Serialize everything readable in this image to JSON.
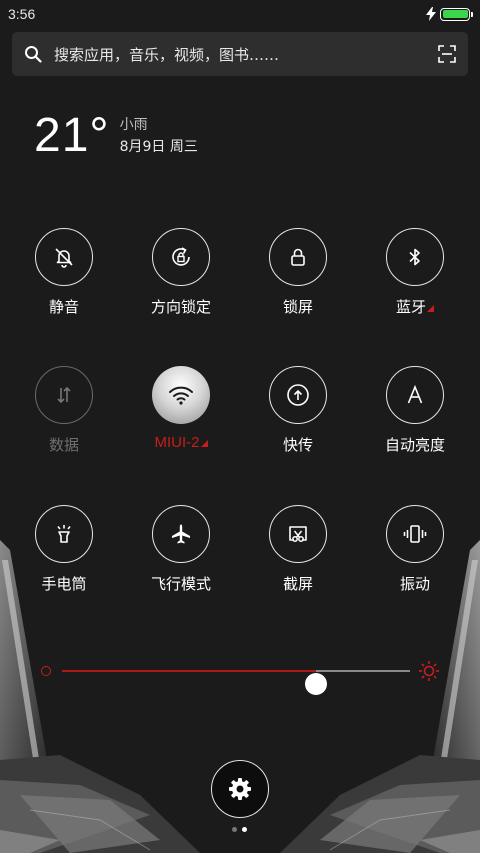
{
  "status_bar": {
    "time": "3:56"
  },
  "search": {
    "placeholder": "搜索应用，音乐，视频，图书……"
  },
  "weather": {
    "temperature": "21°",
    "condition": "小雨",
    "date": "8月9日 周三"
  },
  "toggles": [
    {
      "label": "静音",
      "icon": "bell-off-icon",
      "state": "off"
    },
    {
      "label": "方向锁定",
      "icon": "rotation-lock-icon",
      "state": "off"
    },
    {
      "label": "锁屏",
      "icon": "lock-icon",
      "state": "off"
    },
    {
      "label": "蓝牙",
      "icon": "bluetooth-icon",
      "state": "off"
    },
    {
      "label": "数据",
      "icon": "data-arrows-icon",
      "state": "disabled"
    },
    {
      "label": "MIUI-2",
      "icon": "wifi-icon",
      "state": "on"
    },
    {
      "label": "快传",
      "icon": "quick-transfer-icon",
      "state": "off"
    },
    {
      "label": "自动亮度",
      "icon": "auto-brightness-icon",
      "state": "off"
    },
    {
      "label": "手电筒",
      "icon": "flashlight-icon",
      "state": "off"
    },
    {
      "label": "飞行模式",
      "icon": "airplane-icon",
      "state": "off"
    },
    {
      "label": "截屏",
      "icon": "screenshot-icon",
      "state": "off"
    },
    {
      "label": "振动",
      "icon": "vibrate-icon",
      "state": "off"
    }
  ],
  "brightness": {
    "level": 0.73
  },
  "page_indicator": {
    "current": 2,
    "total": 2
  },
  "colors": {
    "accent": "#c81d1d",
    "active_wifi": "#d6d6d6",
    "battery": "#39d54a",
    "background": "#1b1b1b"
  }
}
